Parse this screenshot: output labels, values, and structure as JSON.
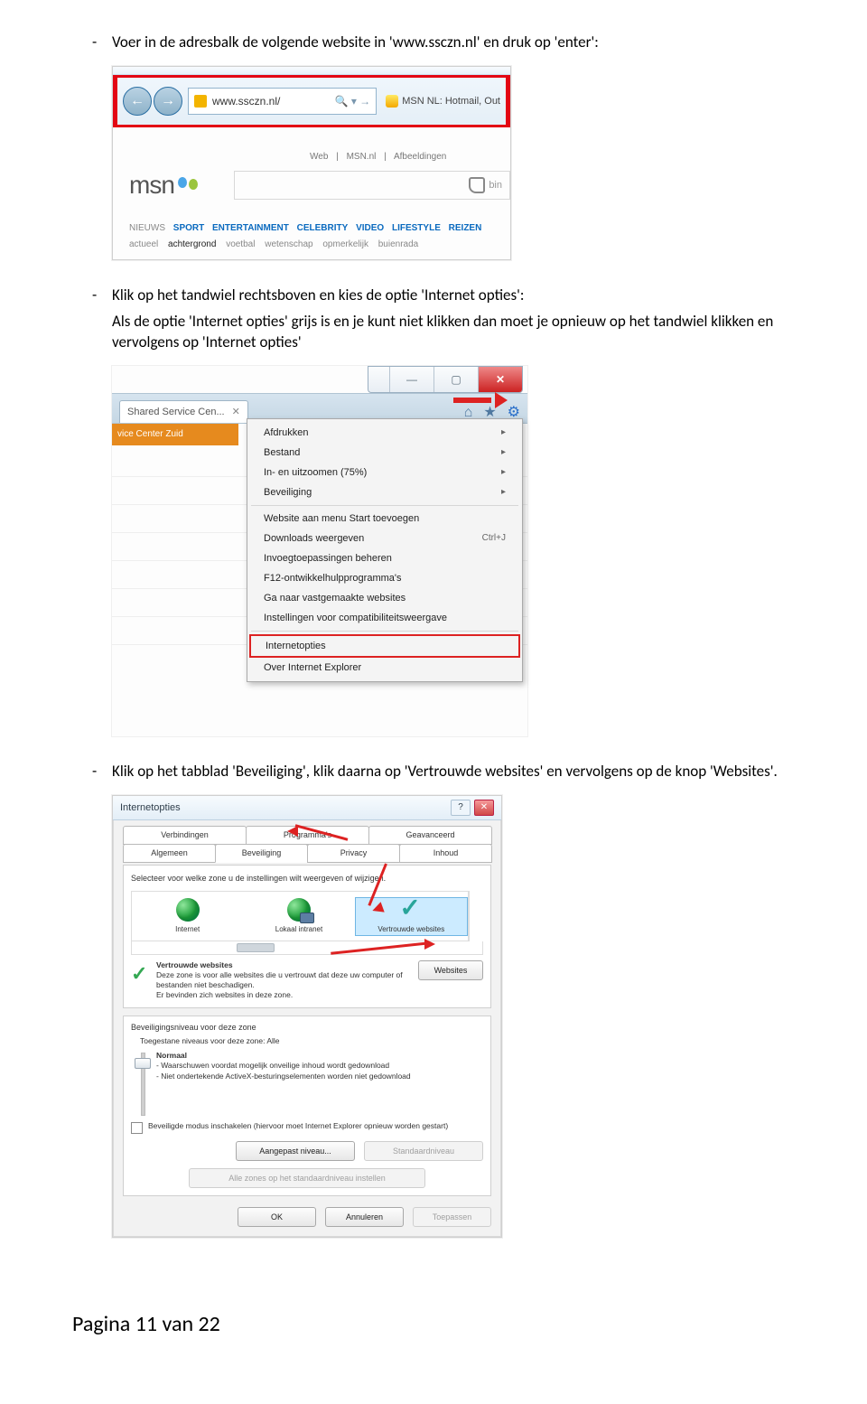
{
  "bullet1": "Voer in de adresbalk de volgende website in 'www.ssczn.nl' en druk op 'enter':",
  "bullet2": "Klik op het tandwiel rechtsboven en kies de optie 'Internet opties':",
  "bullet2_sub": "Als de optie 'Internet opties' grijs is en je kunt niet klikken dan moet je opnieuw op het tandwiel klikken en vervolgens op 'Internet opties'",
  "bullet3": "Klik op het tabblad 'Beveiliging', klik daarna op 'Vertrouwde websites' en vervolgens op de knop 'Websites'.",
  "ss1": {
    "address": "www.ssczn.nl/",
    "search_glyph": "🔍 ▾ →",
    "tab_label": "MSN NL: Hotmail, Out",
    "subnav": [
      "Web",
      "|",
      "MSN.nl",
      "|",
      "Afbeeldingen"
    ],
    "logo": "msn",
    "search_hint": "bin",
    "cats": [
      "NIEUWS",
      "SPORT",
      "ENTERTAINMENT",
      "CELEBRITY",
      "VIDEO",
      "LIFESTYLE",
      "REIZEN"
    ],
    "cats2": [
      "actueel",
      "achtergrond",
      "voetbal",
      "wetenschap",
      "opmerkelijk",
      "buienrada"
    ]
  },
  "ss2": {
    "tab": "Shared Service Cen...",
    "strip": "vice Center Zuid",
    "menu": [
      {
        "t": "Afdrukken",
        "s": "▸"
      },
      {
        "t": "Bestand",
        "s": "▸"
      },
      {
        "t": "In- en uitzoomen (75%)",
        "s": "▸"
      },
      {
        "t": "Beveiliging",
        "s": "▸"
      },
      {
        "sep": true
      },
      {
        "t": "Website aan menu Start toevoegen"
      },
      {
        "t": "Downloads weergeven",
        "s": "Ctrl+J"
      },
      {
        "t": "Invoegtoepassingen beheren"
      },
      {
        "t": "F12-ontwikkelhulpprogramma's"
      },
      {
        "t": "Ga naar vastgemaakte websites"
      },
      {
        "t": "Instellingen voor compatibiliteitsweergave"
      },
      {
        "sep": true
      },
      {
        "t": "Internetopties",
        "hl": true
      },
      {
        "t": "Over Internet Explorer"
      }
    ],
    "winbtns": [
      "—",
      "▢",
      "✕"
    ]
  },
  "ss3": {
    "title": "Internetopties",
    "tabs_r1": [
      "Verbindingen",
      "Programma's",
      "Geavanceerd"
    ],
    "tabs_r2": [
      "Algemeen",
      "Beveiliging",
      "Privacy",
      "Inhoud"
    ],
    "zone_hint": "Selecteer voor welke zone u de instellingen wilt weergeven of wijzigen.",
    "zones": [
      "Internet",
      "Lokaal intranet",
      "Vertrouwde websites"
    ],
    "zdesc_title": "Vertrouwde websites",
    "zdesc_body1": "Deze zone is voor alle websites die u vertrouwt dat deze uw computer of bestanden niet beschadigen.",
    "zdesc_body2": "Er bevinden zich websites in deze zone.",
    "websites_btn": "Websites",
    "sec_header": "Beveiligingsniveau voor deze zone",
    "sec_allowed": "Toegestane niveaus voor deze zone: Alle",
    "sec_level": "Normaal",
    "sec_line1": "- Waarschuwen voordat mogelijk onveilige inhoud wordt gedownload",
    "sec_line2": "- Niet ondertekende ActiveX-besturingselementen worden niet gedownload",
    "chk_label": "Beveiligde modus inschakelen (hiervoor moet Internet Explorer opnieuw worden gestart)",
    "btn_custom": "Aangepast niveau...",
    "btn_default": "Standaardniveau",
    "btn_allzones": "Alle zones op het standaardniveau instellen",
    "btn_ok": "OK",
    "btn_cancel": "Annuleren",
    "btn_apply": "Toepassen"
  },
  "footer_a": "Pagina ",
  "footer_b": "11",
  "footer_c": " van ",
  "footer_d": "22"
}
